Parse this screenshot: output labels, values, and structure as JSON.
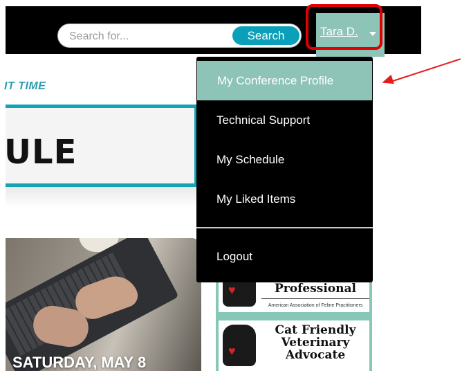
{
  "header": {
    "search_placeholder": "Search for...",
    "search_button_label": "Search",
    "user_name": "Tara D."
  },
  "breadcrumb_text": "IT TIME",
  "page_title": "ULE",
  "event_card": {
    "date_label": "SATURDAY, MAY 8"
  },
  "ads": [
    {
      "lines": [
        "Professional"
      ],
      "subtitle": "American Association of Feline Practitioners"
    },
    {
      "lines": [
        "Cat Friendly",
        "Veterinary",
        "Advocate"
      ]
    }
  ],
  "user_dropdown": {
    "items": [
      {
        "label": "My Conference Profile",
        "active": true
      },
      {
        "label": "Technical Support"
      },
      {
        "label": "My Schedule"
      },
      {
        "label": "My Liked Items"
      },
      {
        "label": "Logout"
      }
    ]
  },
  "colors": {
    "accent_teal": "#0aa0b9",
    "menu_active": "#8ec3b7",
    "annotation_red": "#e51c1c"
  },
  "icons": [
    "caret-down-icon",
    "cat-icon",
    "heart-icon",
    "red-arrow-annotation"
  ]
}
